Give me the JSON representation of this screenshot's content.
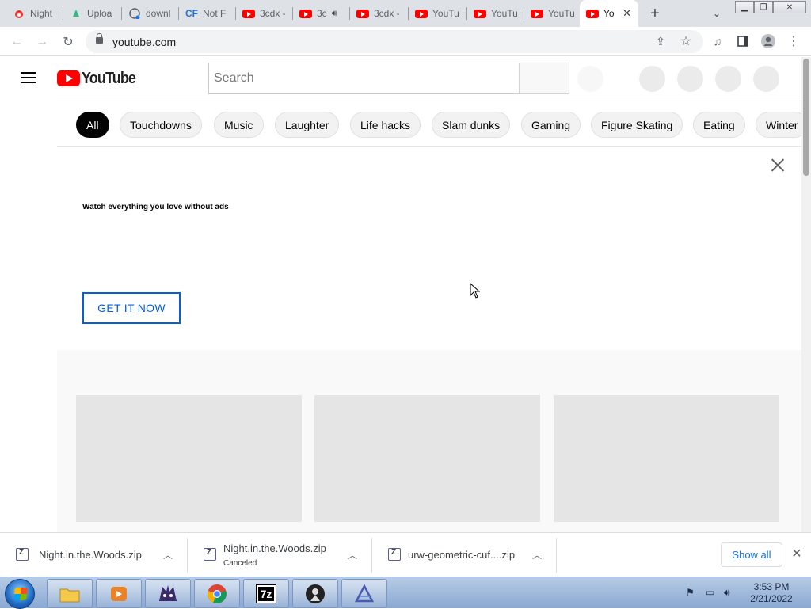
{
  "tabs": [
    {
      "title": "Night",
      "favicon": "fire-icon",
      "active": false
    },
    {
      "title": "Uploa",
      "favicon": "teal-logo-icon",
      "active": false
    },
    {
      "title": "downl",
      "favicon": "globe-icon",
      "active": false
    },
    {
      "title": "Not F",
      "favicon": "cf-icon",
      "active": false
    },
    {
      "title": "3cdx -",
      "favicon": "youtube-icon",
      "active": false
    },
    {
      "title": "3c",
      "favicon": "youtube-icon",
      "active": false,
      "audio": true
    },
    {
      "title": "3cdx -",
      "favicon": "youtube-icon",
      "active": false
    },
    {
      "title": "YouTu",
      "favicon": "youtube-icon",
      "active": false
    },
    {
      "title": "YouTu",
      "favicon": "youtube-icon",
      "active": false
    },
    {
      "title": "YouTu",
      "favicon": "youtube-icon",
      "active": false
    },
    {
      "title": "Yo",
      "favicon": "youtube-icon",
      "active": true
    }
  ],
  "address": {
    "url": "youtube.com"
  },
  "youtube": {
    "logo_text": "YouTube",
    "search_placeholder": "Search",
    "chips": [
      "All",
      "Touchdowns",
      "Music",
      "Laughter",
      "Life hacks",
      "Slam dunks",
      "Gaming",
      "Figure Skating",
      "Eating",
      "Winter"
    ],
    "selected_chip": "All",
    "ad_text": "Watch everything you love without ads",
    "ad_button": "GET IT NOW"
  },
  "downloads": [
    {
      "name": "Night.in.the.Woods.zip",
      "status": ""
    },
    {
      "name": "Night.in.the.Woods.zip",
      "status": "Canceled"
    },
    {
      "name": "urw-geometric-cuf....zip",
      "status": ""
    }
  ],
  "download_bar": {
    "show_all": "Show all"
  },
  "taskbar": {
    "apps": [
      "folder-icon",
      "media-player-icon",
      "game-icon",
      "chrome-icon",
      "7zip-icon",
      "person-icon",
      "app-icon"
    ],
    "app_labels": {
      "zip": "7z"
    },
    "time": "3:53 PM",
    "date": "2/21/2022"
  },
  "colors": {
    "accent": "#065fd4",
    "brand": "#ff0000",
    "chip_selected": "#030303"
  }
}
